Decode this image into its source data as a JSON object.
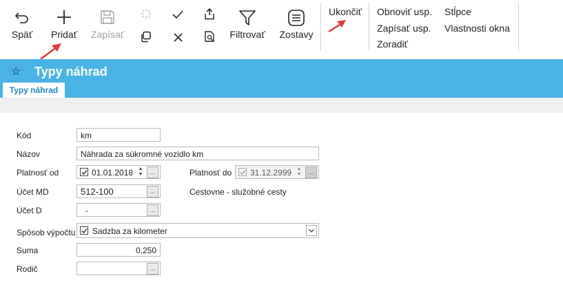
{
  "toolbar": {
    "back_label": "Späť",
    "add_label": "Pridať",
    "save_label": "Zapísať",
    "filter_label": "Filtrovať",
    "reports_label": "Zostavy",
    "exit_label": "Ukončiť",
    "refresh_settings": "Obnoviť usp.",
    "save_settings": "Zapísať usp.",
    "sort": "Zoradiť",
    "columns": "Stĺpce",
    "window_properties": "Vlastnosti okna"
  },
  "header": {
    "title": "Typy náhrad",
    "tab": "Typy náhrad"
  },
  "form": {
    "kod_label": "Kód",
    "kod_value": "km",
    "nazov_label": "Názov",
    "nazov_value": "Náhrada za súkromné vozidlo  km",
    "platnost_od_label": "Platnosť od",
    "platnost_od_value": "01.01.2018",
    "platnost_do_label": "Platnosť do",
    "platnost_do_value": "31.12.2999",
    "ucet_md_label": "Účet MD",
    "ucet_md_value": "512-100",
    "ucet_md_desc": "Cestovne - služobné cesty",
    "ucet_d_label": "Účet D",
    "ucet_d_value": "-",
    "sposob_label": "Spôsob výpočtu",
    "sposob_value": "Sadzba za kilometer",
    "suma_label": "Suma",
    "suma_value": "0,250",
    "rodic_label": "Rodič",
    "rodic_value": "",
    "ellipsis": "..."
  },
  "colors": {
    "accent": "#4ab3e6",
    "tab_text": "#1e88c8",
    "arrow": "#e53935"
  }
}
